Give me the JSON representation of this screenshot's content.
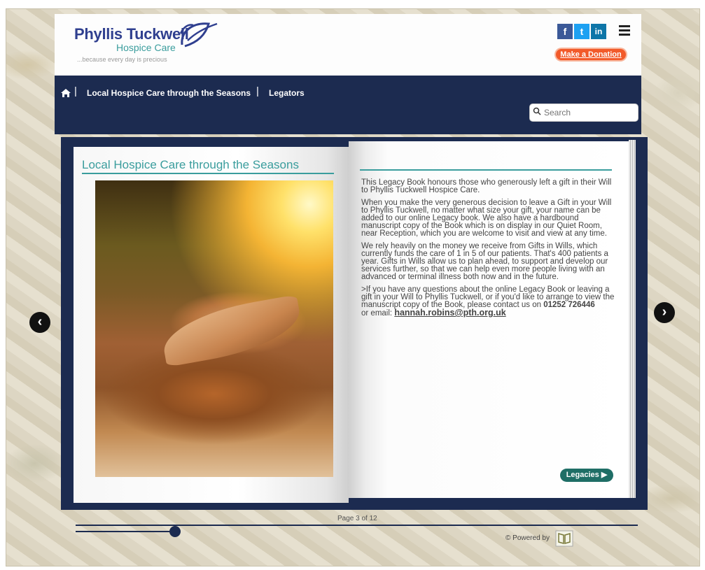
{
  "header": {
    "logo_name": "Phyllis Tuckwell",
    "logo_sub": "Hospice Care",
    "logo_tagline": "...because every day is precious",
    "social": [
      {
        "icon": "facebook-icon",
        "glyph": "f",
        "color": "#3b5998"
      },
      {
        "icon": "twitter-icon",
        "glyph": "t",
        "color": "#1da1f2"
      },
      {
        "icon": "linkedin-icon",
        "glyph": "in",
        "color": "#0e76a8"
      }
    ],
    "menu_icon": "hamburger-menu-icon",
    "donate_label": "Make a Donation",
    "donate_color": "#f25a2a"
  },
  "nav": {
    "home_icon": "home-icon",
    "items": [
      "Local Hospice Care through the Seasons",
      "Legators"
    ],
    "search_placeholder": "Search"
  },
  "book": {
    "left_title": "Local Hospice Care through the Seasons",
    "photo": "autumn-leaves-photo",
    "paragraphs": [
      "This Legacy Book honours those who generously left a gift in their Will to Phyllis Tuckwell Hospice Care.",
      "When you make the very generous decision to leave a Gift in your Will to Phyllis Tuckwell, no matter what size your gift, your name can be added to our online Legacy book. We also have a hardbound manuscript copy of the Book which is on display in our Quiet Room, near Reception, which you are welcome to visit and view at any time.",
      "We rely heavily on the money we receive from Gifts in Wills, which currently funds the care of 1 in 5 of our patients. That's 400 patients a year. Gifts in Wills allow us to plan ahead, to support and develop our services further, so that we can help even more people living with an advanced or terminal illness both now and in the future."
    ],
    "contact_intro": ">If you have any questions about the online Legacy Book or leaving a gift in your Will to Phyllis Tuckwell, or if you'd like to arrange to view the manuscript copy of the Book, please contact us on",
    "phone": "01252 726446",
    "email_prefix": "or email:",
    "email": "hannah.robins@pth.org.uk",
    "legacies_label": "Legacies",
    "prev_icon": "chevron-left-icon",
    "next_icon": "chevron-right-icon"
  },
  "footer": {
    "page_indicator": "Page 3 of 12",
    "slider_progress": 0.17,
    "powered_by": "Powered by",
    "powered_icon": "book-logo-icon"
  },
  "colors": {
    "navy": "#1c2b50",
    "teal": "#3a9d9d",
    "legacies_button": "#1f6e66"
  }
}
